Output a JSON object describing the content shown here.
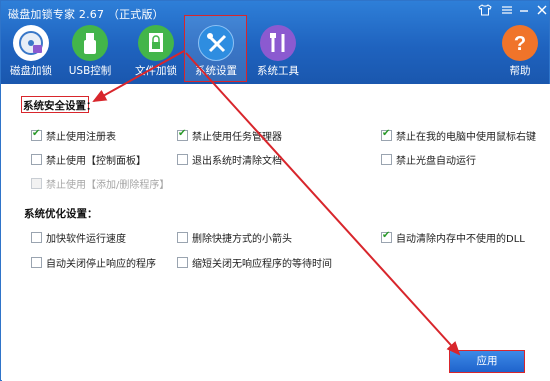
{
  "window": {
    "title": "磁盘加锁专家 2.67 （正式版）"
  },
  "controls": {
    "shirt_icon": "shirt-icon",
    "menu_icon": "menu-icon",
    "minimize_icon": "minimize-icon",
    "close_icon": "close-icon"
  },
  "toolbar": {
    "items": [
      {
        "label": "磁盘加锁",
        "icon": "disk-lock-icon",
        "color": "#ffffff"
      },
      {
        "label": "USB控制",
        "icon": "usb-icon",
        "color": "#43b54a"
      },
      {
        "label": "文件加锁",
        "icon": "file-lock-icon",
        "color": "#43b54a"
      },
      {
        "label": "系统设置",
        "icon": "wrench-screwdriver-icon",
        "color": "#2e8de0"
      },
      {
        "label": "系统工具",
        "icon": "tools-icon",
        "color": "#8b5ad0"
      },
      {
        "label": "帮助",
        "icon": "help-icon",
        "color": "#f0742a"
      }
    ],
    "active": "系统设置"
  },
  "security": {
    "title": "系统安全设置：",
    "options": [
      {
        "label": "禁止使用注册表",
        "checked": true
      },
      {
        "label": "禁止使用任务管理器",
        "checked": true
      },
      {
        "label": "禁止在我的电脑中使用鼠标右键",
        "checked": true
      },
      {
        "label": "禁止使用【控制面板】",
        "checked": false
      },
      {
        "label": "退出系统时清除文档",
        "checked": false
      },
      {
        "label": "禁止光盘自动运行",
        "checked": false
      },
      {
        "label": "禁止使用【添加/删除程序】",
        "checked": false,
        "disabled": true
      }
    ]
  },
  "optimize": {
    "title": "系统优化设置：",
    "options": [
      {
        "label": "加快软件运行速度",
        "checked": false
      },
      {
        "label": "删除快捷方式的小箭头",
        "checked": false
      },
      {
        "label": "自动清除内存中不使用的DLL",
        "checked": true
      },
      {
        "label": "自动关闭停止响应的程序",
        "checked": false
      },
      {
        "label": "缩短关闭无响应程序的等待时间",
        "checked": false
      }
    ]
  },
  "apply": {
    "label": "应用"
  },
  "colors": {
    "accent": "#1f63bf",
    "annotation": "#d8262c",
    "check": "#2a9a2a"
  }
}
